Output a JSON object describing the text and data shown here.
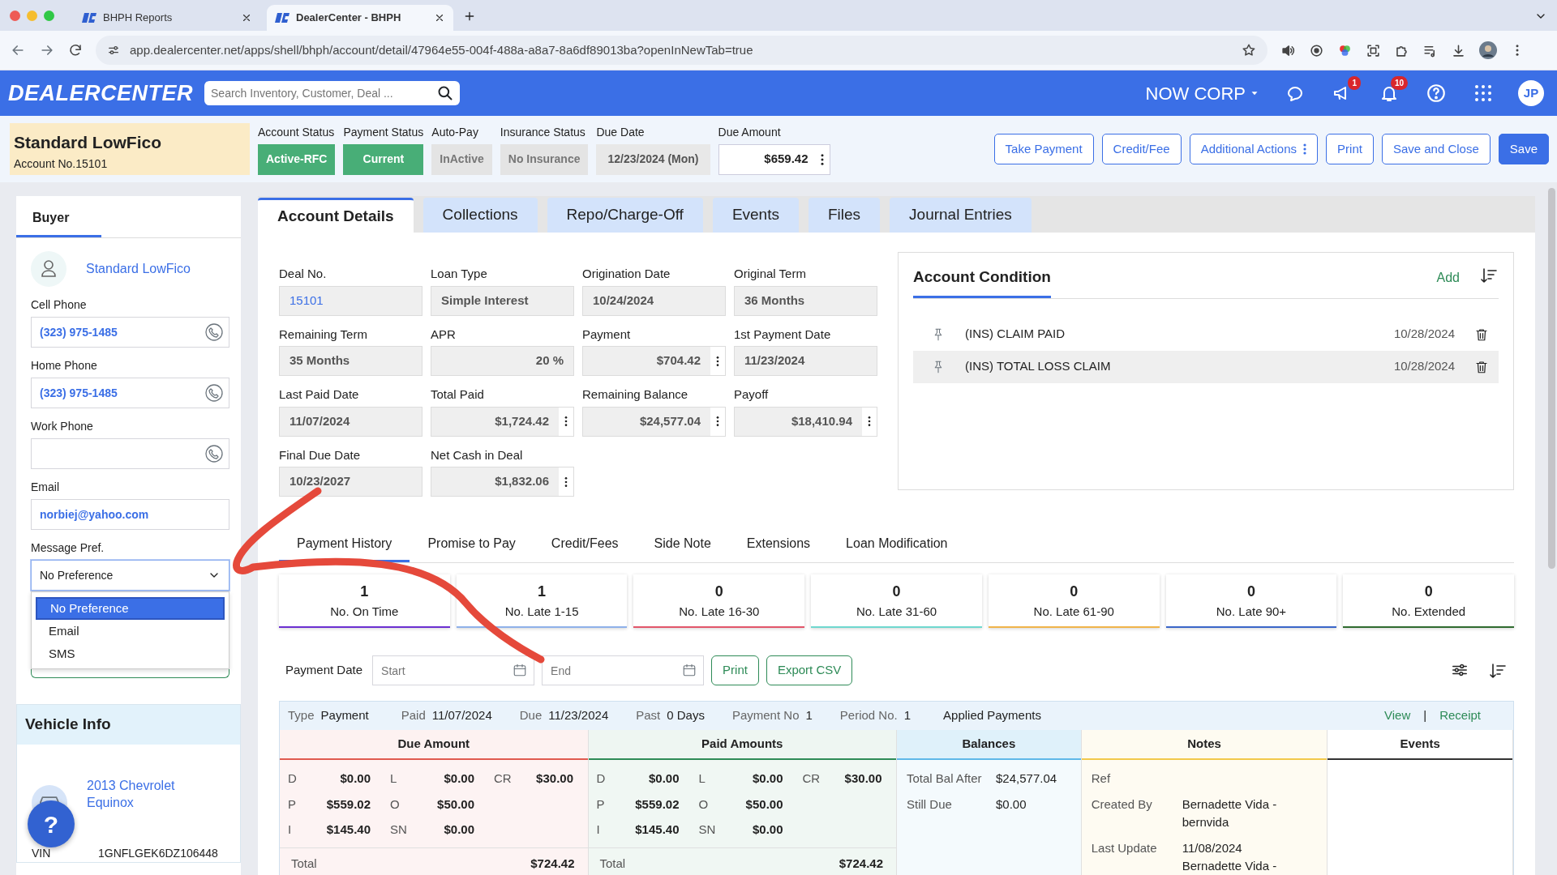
{
  "browser": {
    "tabs": [
      {
        "title": "BHPH Reports",
        "selected": false
      },
      {
        "title": "DealerCenter - BHPH",
        "selected": true
      }
    ],
    "url": "app.dealercenter.net/apps/shell/bhph/account/detail/47964e55-004f-488a-a8a7-8a6df89013ba?openInNewTab=true"
  },
  "app_header": {
    "logo": "DEALERCENTER",
    "search": {
      "placeholder": "Search Inventory, Customer, Deal ..."
    },
    "company": "NOW CORP",
    "announcement_count": "1",
    "notification_count": "10",
    "avatar": "JP"
  },
  "account": {
    "name": "Standard LowFico",
    "number_label": "Account No.",
    "number": "15101",
    "statuses": [
      {
        "label": "Account Status",
        "value": "Active-RFC",
        "kind": "success"
      },
      {
        "label": "Payment Status",
        "value": "Current",
        "kind": "success"
      },
      {
        "label": "Auto-Pay",
        "value": "InActive",
        "kind": "muted"
      },
      {
        "label": "Insurance Status",
        "value": "No Insurance",
        "kind": "muted"
      },
      {
        "label": "Due Date",
        "value": "12/23/2024 (Mon)",
        "kind": "date"
      }
    ],
    "due_amount": {
      "label": "Due Amount",
      "value": "$659.42"
    }
  },
  "actions": [
    {
      "label": "Take Payment",
      "kind": "outline",
      "has_menu": false
    },
    {
      "label": "Credit/Fee",
      "kind": "outline",
      "has_menu": false
    },
    {
      "label": "Additional Actions",
      "kind": "outline",
      "has_menu": true
    },
    {
      "label": "Print",
      "kind": "outline",
      "has_menu": false
    },
    {
      "label": "Save and Close",
      "kind": "outline",
      "has_menu": false
    },
    {
      "label": "Save",
      "kind": "primary",
      "has_menu": false
    }
  ],
  "sidebar": {
    "tabs": [
      {
        "label": "Buyer",
        "selected": true
      }
    ],
    "buyer_name": "Standard LowFico",
    "fields": [
      {
        "label": "Cell Phone",
        "value": "(323) 975-1485",
        "kind": "phone"
      },
      {
        "label": "Home Phone",
        "value": "(323) 975-1485",
        "kind": "phone"
      },
      {
        "label": "Work Phone",
        "kind": "phone"
      },
      {
        "label": "Email",
        "value": "norbiej@yahoo.com",
        "kind": "text"
      }
    ],
    "message_pref": {
      "label": "Message Pref.",
      "value": "No Preference",
      "expanded": true,
      "options": [
        {
          "label": "No Preference",
          "selected": true
        },
        {
          "label": "Email",
          "selected": false
        },
        {
          "label": "SMS",
          "selected": false
        }
      ]
    },
    "vehicle": {
      "title": "Vehicle Info",
      "name": "2013 Chevrolet Equinox",
      "vin_label": "VIN",
      "vin": "1GNFLGEK6DZ106448"
    }
  },
  "help_button": "?",
  "tabs": [
    {
      "label": "Account Details",
      "selected": true
    },
    {
      "label": "Collections",
      "selected": false
    },
    {
      "label": "Repo/Charge-Off",
      "selected": false
    },
    {
      "label": "Events",
      "selected": false
    },
    {
      "label": "Files",
      "selected": false
    },
    {
      "label": "Journal Entries",
      "selected": false
    }
  ],
  "details": [
    {
      "label": "Deal No.",
      "value": "15101",
      "kind": "link",
      "has_menu": false
    },
    {
      "label": "Loan Type",
      "value": "Simple Interest",
      "kind": "text",
      "has_menu": false
    },
    {
      "label": "Origination Date",
      "value": "10/24/2024",
      "kind": "text",
      "has_menu": false
    },
    {
      "label": "Original Term",
      "value": "36 Months",
      "kind": "text",
      "has_menu": false
    },
    {
      "label": "Remaining Term",
      "value": "35 Months",
      "kind": "text",
      "has_menu": false
    },
    {
      "label": "APR",
      "value": "20 %",
      "kind": "amount",
      "has_menu": false
    },
    {
      "label": "Payment",
      "value": "$704.42",
      "kind": "amount",
      "has_menu": true
    },
    {
      "label": "1st Payment Date",
      "value": "11/23/2024",
      "kind": "text",
      "has_menu": false
    },
    {
      "label": "Last Paid Date",
      "value": "11/07/2024",
      "kind": "text",
      "has_menu": false
    },
    {
      "label": "Total Paid",
      "value": "$1,724.42",
      "kind": "amount",
      "has_menu": true
    },
    {
      "label": "Remaining Balance",
      "value": "$24,577.04",
      "kind": "amount",
      "has_menu": true
    },
    {
      "label": "Payoff",
      "value": "$18,410.94",
      "kind": "amount",
      "has_menu": true
    },
    {
      "label": "Final Due Date",
      "value": "10/23/2027",
      "kind": "text",
      "has_menu": false
    },
    {
      "label": "Net Cash in Deal",
      "value": "$1,832.06",
      "kind": "amount",
      "has_menu": true
    }
  ],
  "account_condition": {
    "title": "Account Condition",
    "add": "Add",
    "items": [
      {
        "text": "(INS) CLAIM PAID",
        "date": "10/28/2024",
        "highlighted": false
      },
      {
        "text": "(INS) TOTAL LOSS CLAIM",
        "date": "10/28/2024",
        "highlighted": true
      }
    ]
  },
  "sub_tabs": [
    {
      "label": "Payment History",
      "selected": true
    },
    {
      "label": "Promise to Pay",
      "selected": false
    },
    {
      "label": "Credit/Fees",
      "selected": false
    },
    {
      "label": "Side Note",
      "selected": false
    },
    {
      "label": "Extensions",
      "selected": false
    },
    {
      "label": "Loan Modification",
      "selected": false
    }
  ],
  "stats": [
    {
      "count": "1",
      "label": "No. On Time",
      "color": "#6b2fd1"
    },
    {
      "count": "1",
      "label": "No. Late 1-15",
      "color": "#8fb1ea"
    },
    {
      "count": "0",
      "label": "No. Late 16-30",
      "color": "#e2566a"
    },
    {
      "count": "0",
      "label": "No. Late 31-60",
      "color": "#6fd8cf"
    },
    {
      "count": "0",
      "label": "No. Late 61-90",
      "color": "#f0b44a"
    },
    {
      "count": "0",
      "label": "No. Late 90+",
      "color": "#3a66c9"
    },
    {
      "count": "0",
      "label": "No. Extended",
      "color": "#2f6b2f"
    }
  ],
  "filters": {
    "label": "Payment Date",
    "start": {
      "placeholder": "Start"
    },
    "end": {
      "placeholder": "End"
    },
    "buttons": [
      "Print",
      "Export CSV"
    ]
  },
  "payment": {
    "summary": [
      {
        "label": "Type",
        "value": "Payment"
      },
      {
        "label": "Paid",
        "value": "11/07/2024"
      },
      {
        "label": "Due",
        "value": "11/23/2024"
      },
      {
        "label": "Past",
        "value": "0 Days"
      },
      {
        "label": "Payment No",
        "value": "1"
      },
      {
        "label": "Period No.",
        "value": "1"
      }
    ],
    "title": "Applied Payments",
    "links": [
      "View",
      "Receipt"
    ],
    "separator": "|",
    "columns": [
      {
        "title": "Due Amount",
        "kind": "amounts",
        "color": "#e05a4f",
        "rows": [
          [
            {
              "code": "D",
              "amount": "$0.00"
            },
            {
              "code": "L",
              "amount": "$0.00"
            },
            {
              "code": "CR",
              "amount": "$30.00"
            }
          ],
          [
            {
              "code": "P",
              "amount": "$559.02"
            },
            {
              "code": "O",
              "amount": "$50.00"
            }
          ],
          [
            {
              "code": "I",
              "amount": "$145.40"
            },
            {
              "code": "SN",
              "amount": "$0.00"
            }
          ]
        ],
        "total_label": "Total",
        "total": "$724.42"
      },
      {
        "title": "Paid Amounts",
        "kind": "amounts",
        "color": "#2e8b57",
        "rows": [
          [
            {
              "code": "D",
              "amount": "$0.00"
            },
            {
              "code": "L",
              "amount": "$0.00"
            },
            {
              "code": "CR",
              "amount": "$30.00"
            }
          ],
          [
            {
              "code": "P",
              "amount": "$559.02"
            },
            {
              "code": "O",
              "amount": "$50.00"
            }
          ],
          [
            {
              "code": "I",
              "amount": "$145.40"
            },
            {
              "code": "SN",
              "amount": "$0.00"
            }
          ]
        ],
        "total_label": "Total",
        "total": "$724.42"
      },
      {
        "title": "Balances",
        "kind": "balances",
        "color": "#5fb8e8",
        "items": [
          {
            "label": "Total Bal After",
            "value": "$24,577.04"
          },
          {
            "label": "Still Due",
            "value": "$0.00"
          }
        ]
      },
      {
        "title": "Notes",
        "kind": "notes",
        "color": "#f2c94c",
        "items": [
          {
            "label": "Ref"
          },
          {
            "label": "Created By",
            "lines": [
              "Bernadette Vida - bernvida"
            ]
          },
          {
            "label": "Last Update",
            "lines": [
              "11/08/2024",
              "Bernadette Vida -"
            ]
          }
        ]
      },
      {
        "title": "Events",
        "kind": "events",
        "color": "#333333"
      }
    ]
  }
}
